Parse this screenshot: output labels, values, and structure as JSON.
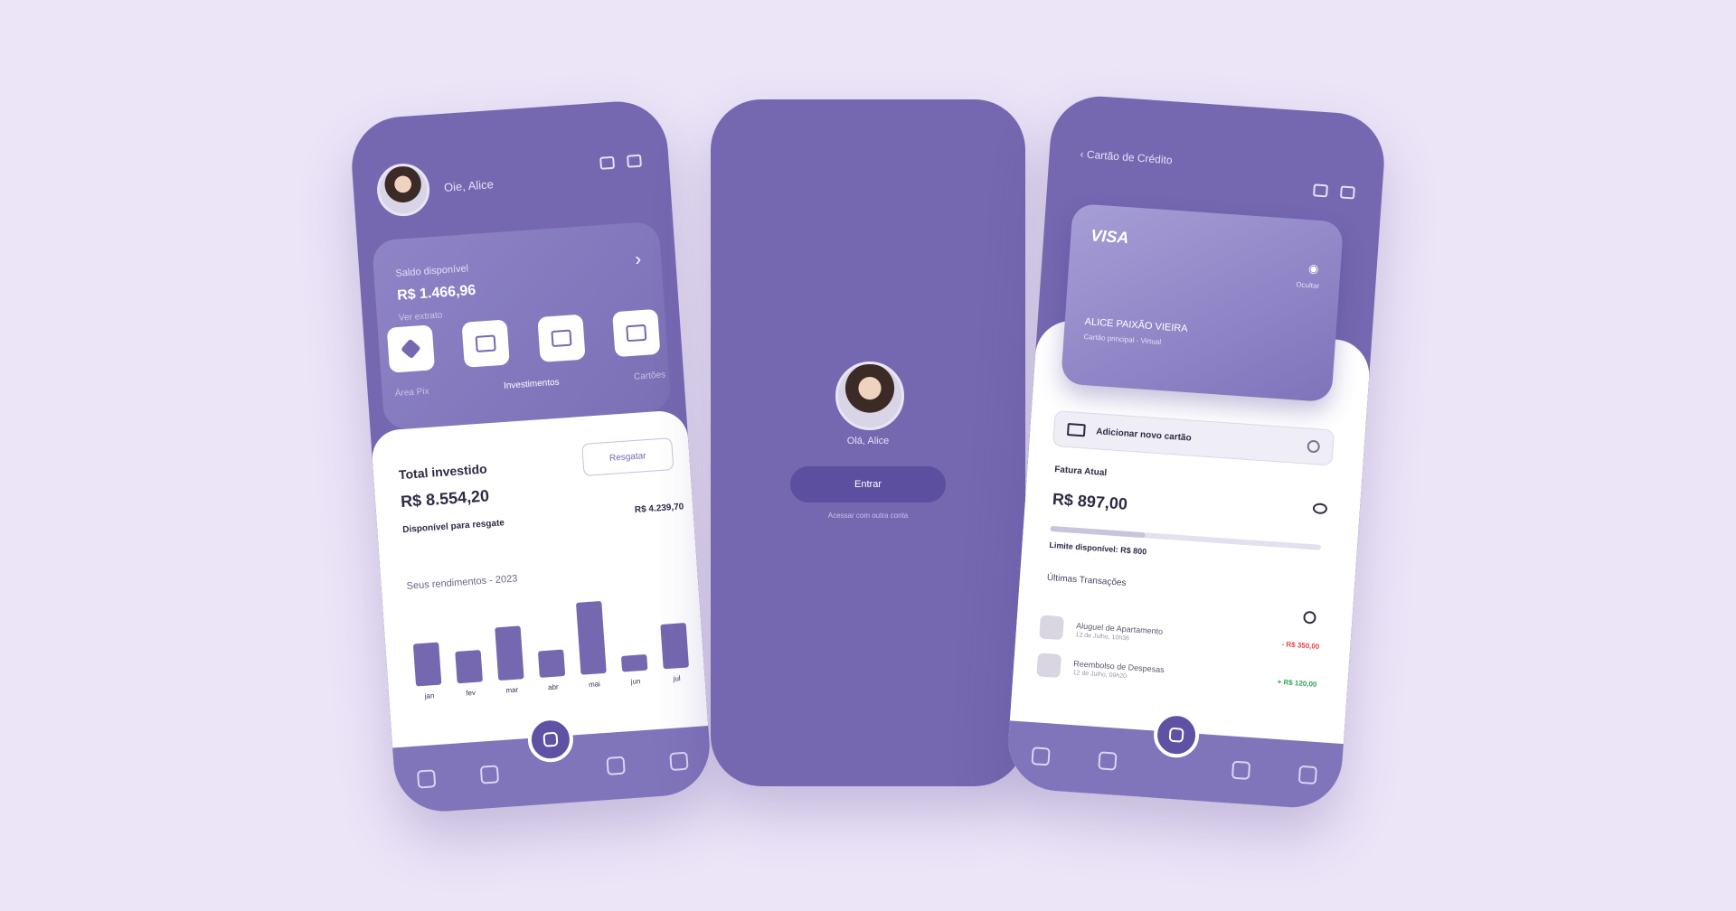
{
  "left_phone": {
    "greeting": "Oie, Alice",
    "balance": {
      "label": "Saldo disponível",
      "value": "R$ 1.466,96",
      "sub": "Ver extrato"
    },
    "actions": [
      "pix",
      "pagar",
      "transferir",
      "agenda"
    ],
    "tabs": [
      "Área Pix",
      "Investimentos",
      "Cartões"
    ],
    "investments": {
      "label": "Total investido",
      "value": "R$ 8.554,20",
      "available_label": "Disponível para resgate",
      "available_value": "R$ 4.239,70",
      "button": "Resgatar"
    },
    "chart_title": "Seus rendimentos - 2023",
    "chart_data": {
      "type": "bar",
      "categories": [
        "jan",
        "fev",
        "mar",
        "abr",
        "mai",
        "jun",
        "jul"
      ],
      "values": [
        40,
        30,
        50,
        25,
        68,
        15,
        42
      ],
      "title": "Seus rendimentos - 2023",
      "xlabel": "",
      "ylabel": "",
      "color": "#7568b0"
    },
    "nav": [
      "home-icon",
      "transfer-icon",
      "wallet-icon",
      "docs-icon",
      "profile-icon"
    ]
  },
  "mid_phone": {
    "name": "Olá, Alice",
    "enter_button": "Entrar",
    "link": "Acessar com outra conta"
  },
  "right_phone": {
    "title": "Cartão de Crédito",
    "card": {
      "brand": "VISA",
      "toggle_label": "Ocultar",
      "holder": "ALICE PAIXÃO VIEIRA",
      "holder_sub": "Cartão principal - Virtual"
    },
    "virtual_card_button": "Adicionar novo cartão",
    "fatura": {
      "label": "Fatura Atual",
      "value": "R$ 897,00",
      "limit": "Limite disponível: R$ 800",
      "progress": 0.35
    },
    "transactions_title": "Últimas Transações",
    "transactions": [
      {
        "title": "Aluguel de Apartamento",
        "date": "12 de Julho, 10h36",
        "amount": "- R$ 350,00",
        "type": "red"
      },
      {
        "title": "Reembolso de Despesas",
        "date": "12 de Julho, 09h20",
        "amount": "+ R$ 120,00",
        "type": "green"
      }
    ]
  },
  "colors": {
    "background": "#ece5f8",
    "primary": "#7568b0",
    "primary_dark": "#5c4fa0"
  }
}
